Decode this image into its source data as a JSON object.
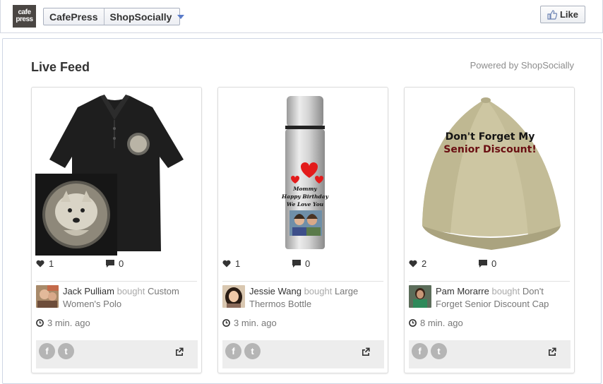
{
  "header": {
    "logo_line1": "cafe",
    "logo_line2": "press",
    "store_name": "CafePress",
    "app_name": "ShopSocially",
    "like_label": "Like"
  },
  "feed": {
    "title": "Live Feed",
    "powered_by": "Powered by ShopSocially"
  },
  "cards": [
    {
      "likes": "1",
      "comments": "0",
      "buyer": "Jack Pulliam",
      "verb": "bought",
      "product": "Custom Women's Polo",
      "time": "3 min. ago"
    },
    {
      "likes": "1",
      "comments": "0",
      "buyer": "Jessie Wang",
      "verb": "bought",
      "product": "Large Thermos Bottle",
      "time": "3 min. ago",
      "bottle_text_1": "Mommy",
      "bottle_text_2": "Happy Birthday",
      "bottle_text_3": "We Love You"
    },
    {
      "likes": "2",
      "comments": "0",
      "buyer": "Pam Morarre",
      "verb": "bought",
      "product": "Don't Forget Senior Discount Cap",
      "time": "8 min. ago",
      "cap_text_1": "Don't Forget My",
      "cap_text_2": "Senior Discount!"
    }
  ],
  "social": {
    "facebook_letter": "f",
    "twitter_letter": "t"
  },
  "colors": {
    "accent_blue": "#5b7cc9",
    "share_bar": "#ededed",
    "social_circle": "#b5b5b5"
  }
}
